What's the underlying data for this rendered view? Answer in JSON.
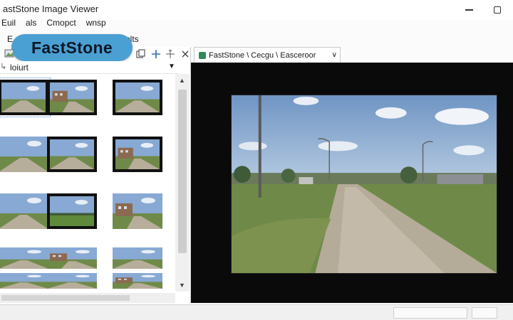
{
  "window": {
    "title": "astStone Image Viewer"
  },
  "menu": [
    "Euil",
    "als",
    "Cmopct",
    "wnsp"
  ],
  "toolbar": {
    "left_text": "E",
    "right_text": "olts"
  },
  "logo": {
    "text": "FastStone"
  },
  "toolbar_icons": [
    "image-icon",
    "folder-up-icon",
    "copy-icon",
    "plus-icon",
    "move-icon",
    "close-x-icon"
  ],
  "folder": {
    "label": "loiurt",
    "left_mark": "↳",
    "dropdown": "▼"
  },
  "tab": {
    "text": "FastStone \\ Cecgu \\ Easceroor",
    "chevron": "∨"
  },
  "scroll": {
    "up": "▲",
    "down": "▼"
  }
}
